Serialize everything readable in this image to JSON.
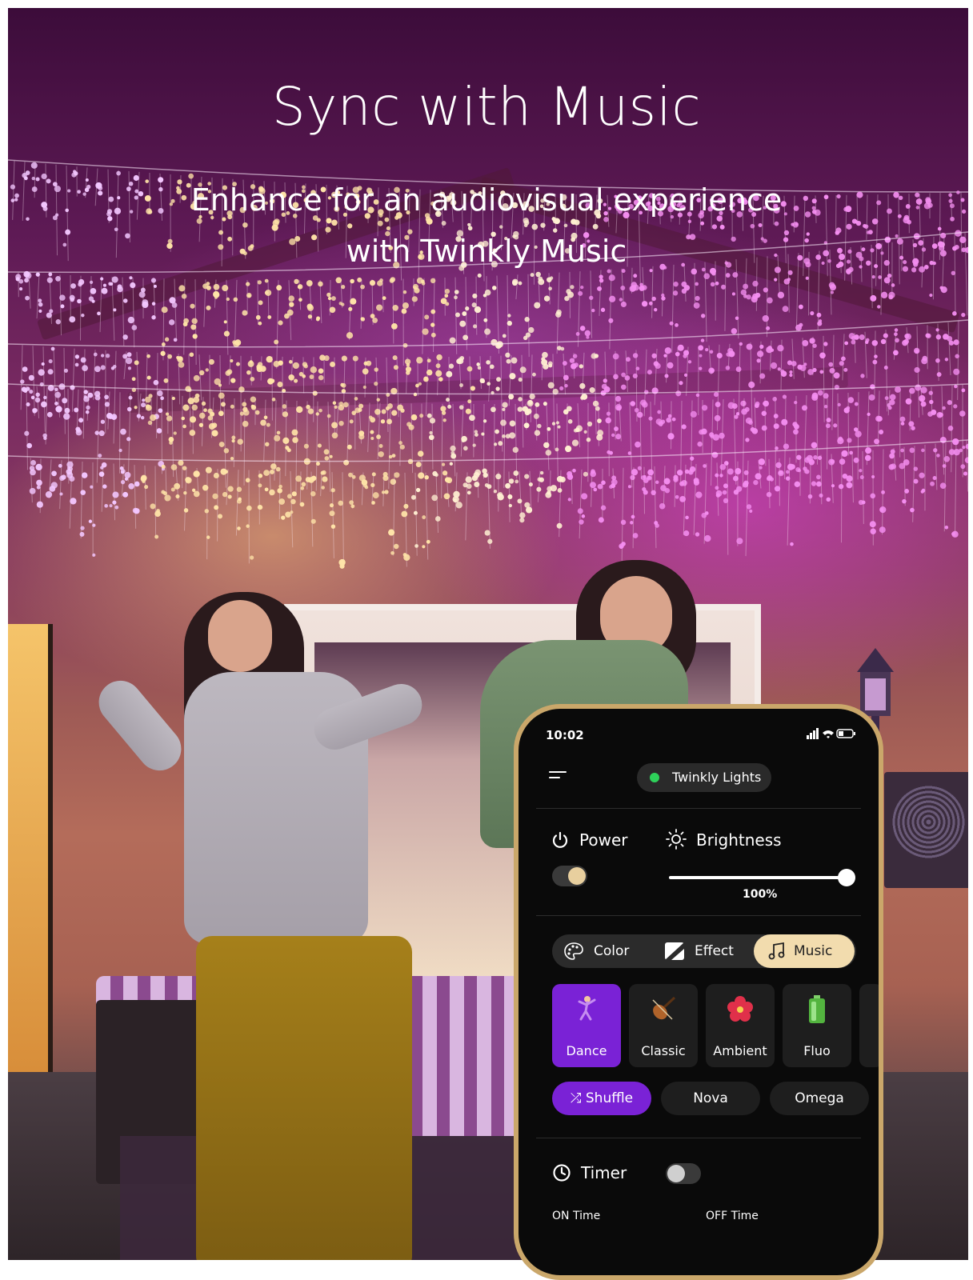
{
  "hero": {
    "headline": "Sync with Music",
    "subline_1": "Enhance for an audiovisual experience",
    "subline_2": "with Twinkly Music"
  },
  "phone": {
    "status_bar": {
      "time": "10:02",
      "icons": "signal wifi battery"
    },
    "header": {
      "menu_icon": "hamburger-icon",
      "device_name": "Twinkly Lights",
      "device_status_color": "#2ed15a"
    },
    "power": {
      "label": "Power",
      "icon": "power-icon",
      "on": true
    },
    "brightness": {
      "label": "Brightness",
      "icon": "sun-icon",
      "value_label": "100%",
      "value": 1.0
    },
    "mode_tabs": [
      {
        "label": "Color",
        "icon": "palette-icon",
        "active": false
      },
      {
        "label": "Effect",
        "icon": "effect-icon",
        "active": false
      },
      {
        "label": "Music",
        "icon": "music-note-icon",
        "active": true
      }
    ],
    "effects": [
      {
        "label": "Dance",
        "icon": "dancer-icon",
        "active": true
      },
      {
        "label": "Classic",
        "icon": "violin-icon",
        "active": false
      },
      {
        "label": "Ambient",
        "icon": "flower-icon",
        "active": false
      },
      {
        "label": "Fluo",
        "icon": "battery-icon",
        "active": false
      }
    ],
    "presets": [
      {
        "label": "⤮ Shuffle",
        "active": true
      },
      {
        "label": "Nova",
        "active": false
      },
      {
        "label": "Omega",
        "active": false
      }
    ],
    "timer": {
      "label": "Timer",
      "icon": "clock-icon",
      "on": false,
      "on_time_label": "ON Time",
      "off_time_label": "OFF Time"
    }
  },
  "colors": {
    "accent_purple": "#7a22d6",
    "active_tab": "#f2dcae",
    "toggle_on_knob": "#e8cf9e"
  }
}
